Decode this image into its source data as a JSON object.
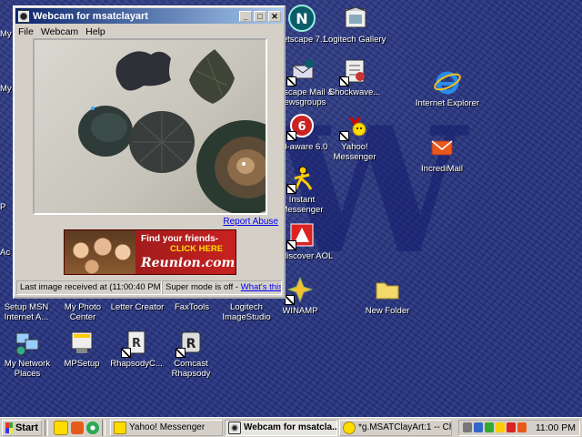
{
  "window": {
    "title": "Webcam for msatclayart",
    "menu": [
      "File",
      "Webcam",
      "Help"
    ],
    "report_abuse": "Report Abuse",
    "ad": {
      "line1": "Find your friends-",
      "line2": "CLICK HERE",
      "brand": "Reunion.com"
    },
    "status_last_image": "Last image received at (11:00:40 PM)",
    "status_super_mode": "Super mode is off - ",
    "status_whats_this": "What's this?"
  },
  "desktop_icons": [
    {
      "label": "Netscape 7.1",
      "icon": "netscape-icon"
    },
    {
      "label": "Logitech Gallery",
      "icon": "gallery-icon"
    },
    {
      "label": "Netscape Mail & Newsgroups",
      "icon": "mail-icon"
    },
    {
      "label": "Shockwave...",
      "icon": "shockwave-icon"
    },
    {
      "label": "Internet Explorer",
      "icon": "ie-icon"
    },
    {
      "label": "Ad-aware 6.0",
      "icon": "adaware-icon"
    },
    {
      "label": "Yahoo! Messenger",
      "icon": "yahoo-icon"
    },
    {
      "label": "IncrediMail",
      "icon": "incredimail-icon"
    },
    {
      "label": "Instant Messenger",
      "icon": "aim-icon"
    },
    {
      "label": "Rediscover AOL",
      "icon": "aol-icon"
    },
    {
      "label": "WINAMP",
      "icon": "winamp-icon"
    },
    {
      "label": "New Folder",
      "icon": "folder-icon"
    },
    {
      "label": "Setup MSN Internet A...",
      "icon": "msn-icon"
    },
    {
      "label": "My Photo Center",
      "icon": "photo-icon"
    },
    {
      "label": "Letter Creator",
      "icon": "letter-icon"
    },
    {
      "label": "FaxTools",
      "icon": "fax-icon"
    },
    {
      "label": "Logitech ImageStudio",
      "icon": "imagestudio-icon"
    },
    {
      "label": "My Network Places",
      "icon": "network-icon"
    },
    {
      "label": "MPSetup",
      "icon": "mpsetup-icon"
    },
    {
      "label": "RhapsodyC...",
      "icon": "rhapsody-icon"
    },
    {
      "label": "Comcast Rhapsody",
      "icon": "comcast-icon"
    }
  ],
  "edge_labels": [
    "My",
    "My",
    "P",
    "Ac"
  ],
  "taskbar": {
    "start": "Start",
    "tasks": [
      {
        "label": "Yahoo! Messenger",
        "active": false
      },
      {
        "label": "Webcam for msatcla...",
        "active": true
      },
      {
        "label": "*g.MSATClayArt:1 -- Chat",
        "active": false
      }
    ],
    "clock": "11:00 PM"
  },
  "colors": {
    "desktop": "#283683",
    "titlebar": "#0a246a",
    "window": "#d4d0c8",
    "ad_red": "#c92020"
  }
}
